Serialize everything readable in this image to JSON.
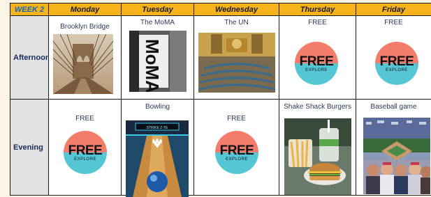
{
  "header": {
    "week": "WEEK 2",
    "days": [
      "Monday",
      "Tuesday",
      "Wednesday",
      "Thursday",
      "Friday"
    ]
  },
  "rows": [
    {
      "label": "Afternoon",
      "cells": [
        {
          "title": "Brooklyn Bridge",
          "image": "brooklyn-bridge-photo"
        },
        {
          "title": "The MoMA",
          "image": "moma-sign-photo"
        },
        {
          "title": "The UN",
          "image": "un-general-assembly-photo"
        },
        {
          "title": "FREE",
          "image": "free-explore-badge"
        },
        {
          "title": "FREE",
          "image": "free-explore-badge"
        }
      ]
    },
    {
      "label": "Evening",
      "cells": [
        {
          "title": "FREE",
          "image": "free-explore-badge"
        },
        {
          "title": "Bowling",
          "image": "bowling-alley-photo"
        },
        {
          "title": "FREE",
          "image": "free-explore-badge"
        },
        {
          "title": "Shake Shack  Burgers",
          "image": "shake-shack-burger-photo"
        },
        {
          "title": "Baseball game",
          "image": "baseball-stadium-photo"
        }
      ]
    }
  ],
  "badge": {
    "big": "FREE",
    "small": "EXPLORE"
  },
  "moma_sign": "MoMA",
  "bowling_sign": "STRIKE Z-TE",
  "colors": {
    "header": "#f6b31b",
    "week": "#1565c0",
    "badge_top": "#f47c6b",
    "badge_bottom": "#55c6d4",
    "rowlabel_bg": "#e2e2e2"
  }
}
